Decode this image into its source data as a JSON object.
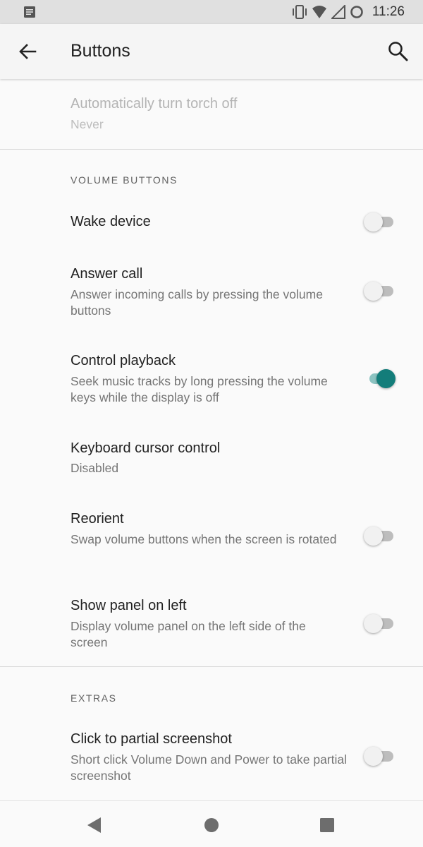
{
  "status_bar": {
    "time": "11:26",
    "icons": [
      "notification-icon",
      "vibrate-icon",
      "wifi-icon",
      "signal-icon",
      "data-saver-icon"
    ]
  },
  "app_bar": {
    "title": "Buttons",
    "back_icon": "arrow-left-icon",
    "search_icon": "search-icon"
  },
  "torch": {
    "title": "Automatically turn torch off",
    "summary": "Never"
  },
  "volume_buttons": {
    "header": "VOLUME BUTTONS",
    "wake_device": {
      "title": "Wake device",
      "enabled": false
    },
    "answer_call": {
      "title": "Answer call",
      "summary": "Answer incoming calls by pressing the volume buttons",
      "enabled": false
    },
    "control_playback": {
      "title": "Control playback",
      "summary": "Seek music tracks by long pressing the volume keys while the display is off",
      "enabled": true
    },
    "keyboard_cursor": {
      "title": "Keyboard cursor control",
      "summary": "Disabled"
    },
    "reorient": {
      "title": "Reorient",
      "summary": "Swap volume buttons when the screen is rotated",
      "enabled": false
    },
    "panel_left": {
      "title": "Show panel on left",
      "summary": "Display volume panel on the left side of the screen",
      "enabled": false
    }
  },
  "extras": {
    "header": "EXTRAS",
    "partial_screenshot": {
      "title": "Click to partial screenshot",
      "summary": "Short click Volume Down and Power to take partial screenshot",
      "enabled": false
    }
  },
  "nav_bar": {
    "icons": [
      "back-triangle-icon",
      "home-circle-icon",
      "recents-square-icon"
    ]
  },
  "colors": {
    "accent": "#137d7a",
    "accent_track": "#8cc3c1"
  }
}
